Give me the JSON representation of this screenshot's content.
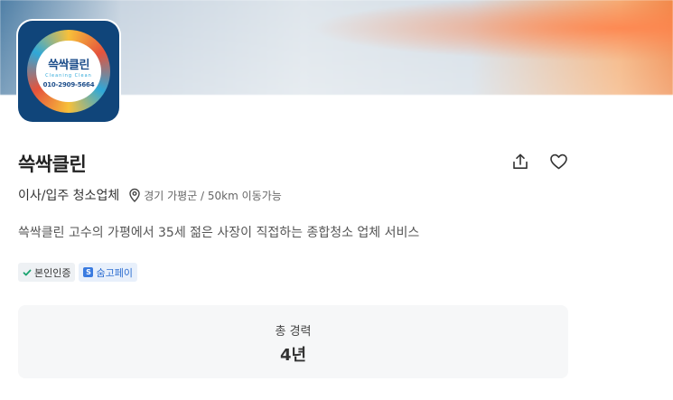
{
  "profile": {
    "name": "쓱싹클린",
    "category": "이사/입주 청소업체",
    "location": "경기 가평군 / 50km 이동가능",
    "description": "쓱싹클린 고수의 가평에서 35세 젊은 사장이 직접하는 종합청소 업체 서비스",
    "logo": {
      "name": "쓱싹클린",
      "subtitle": "Cleaning Clean",
      "phone": "010-2909-5664"
    }
  },
  "badges": [
    {
      "label": "본인인증",
      "icon": "check-icon",
      "color": "#1aa36f"
    },
    {
      "label": "숨고페이",
      "icon": "soomgo-pay-icon",
      "color": "#3a7be0"
    }
  ],
  "career": {
    "label": "총 경력",
    "value": "4년"
  },
  "actions": {
    "share_icon": "share-icon",
    "like_icon": "heart-icon"
  }
}
